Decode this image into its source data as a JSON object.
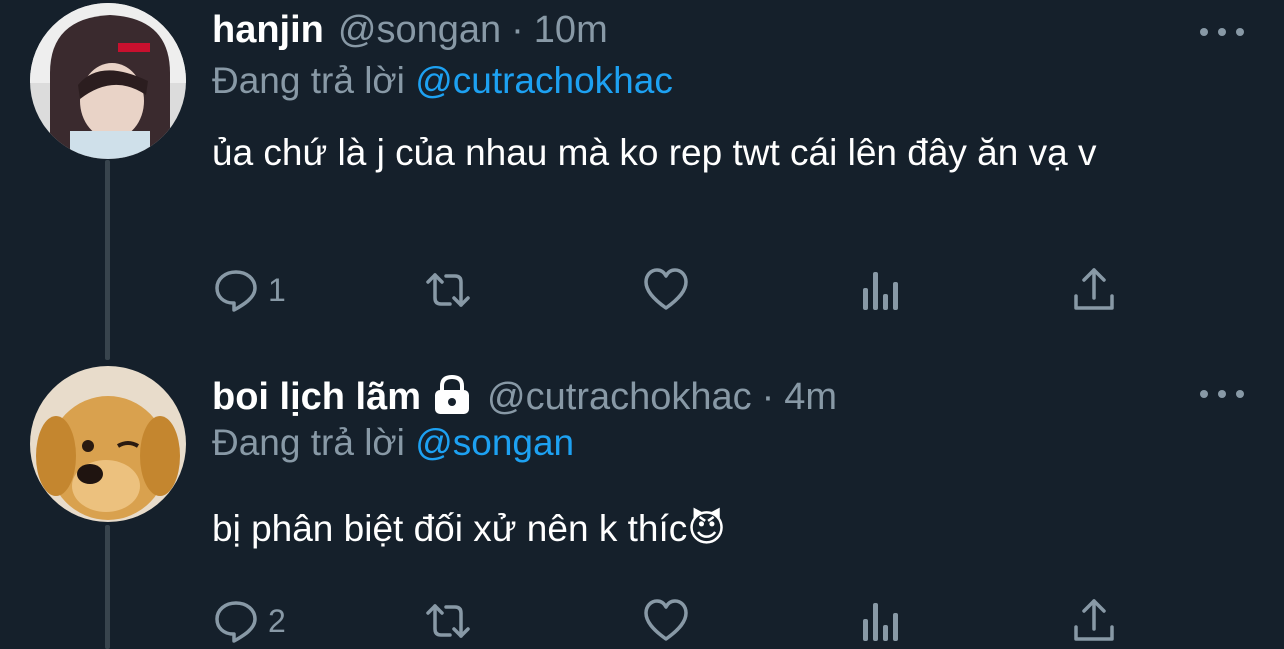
{
  "tweets": [
    {
      "display_name": "hanjin",
      "handle": "@songan",
      "separator": "·",
      "time": "10m",
      "reply_prefix": "Đang trả lời",
      "reply_to": "@cutrachokhac",
      "text": "ủa chứ là j của nhau mà ko rep twt cái lên đây ăn vạ v",
      "reply_count": "1",
      "retweet_count": "",
      "like_count": "",
      "locked": false
    },
    {
      "display_name": "boi lịch lãm",
      "handle": "@cutrachokhac",
      "separator": "·",
      "time": "4m",
      "reply_prefix": "Đang trả lời",
      "reply_to": "@songan",
      "text": "bị phân biệt đối xử nên k thíc😈",
      "reply_count": "2",
      "retweet_count": "",
      "like_count": "",
      "locked": true
    }
  ],
  "icons": {
    "more": "more-horizontal-icon",
    "reply": "reply-icon",
    "retweet": "retweet-icon",
    "like": "heart-icon",
    "analytics": "analytics-icon",
    "share": "share-icon",
    "lock": "lock-icon"
  },
  "colors": {
    "background": "#15202b",
    "secondary_text": "#8899a6",
    "link": "#1da1f2",
    "thread_line": "#38444d"
  }
}
